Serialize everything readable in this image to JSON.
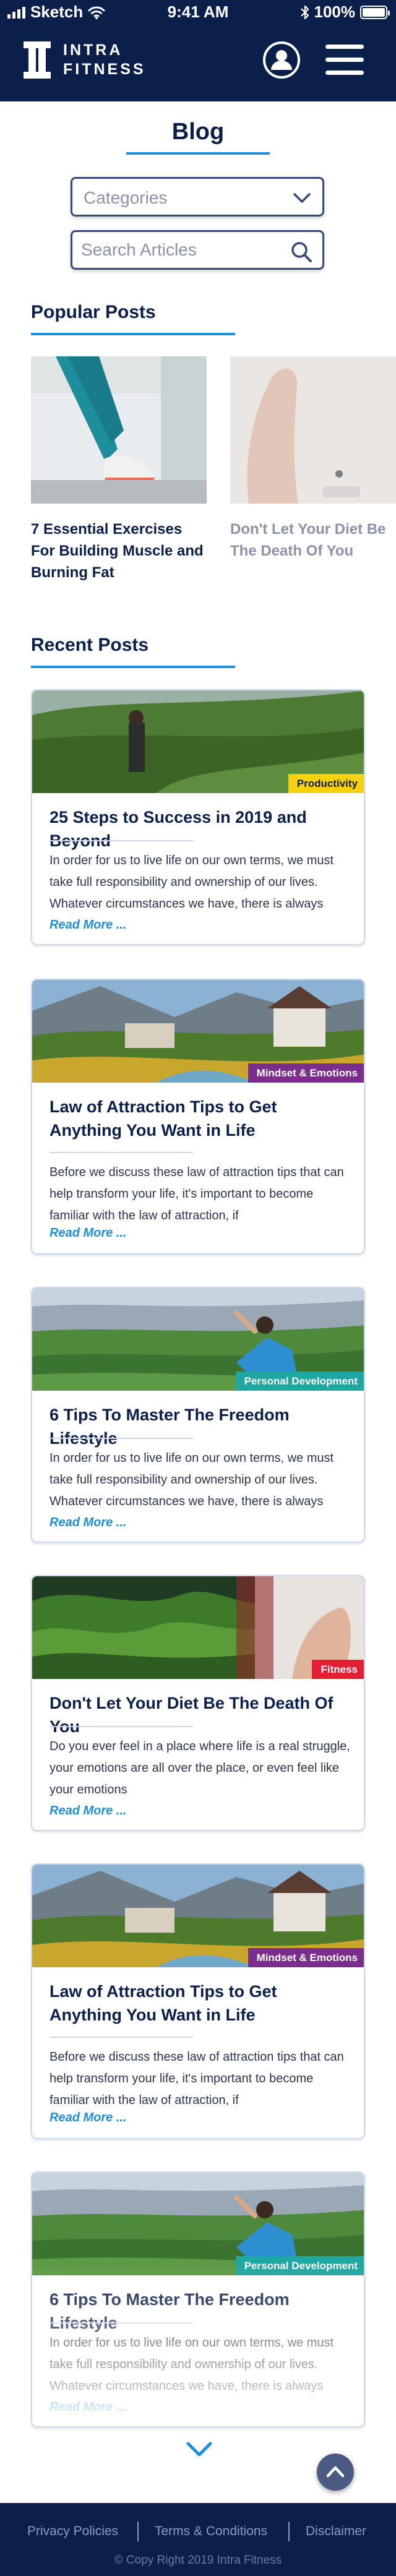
{
  "status_bar": {
    "carrier": "Sketch",
    "time": "9:41 AM",
    "battery": "100%"
  },
  "brand": {
    "line1": "INTRA",
    "line2": "FITNESS"
  },
  "blog_title": "Blog",
  "categories_placeholder": "Categories",
  "search_placeholder": "Search Articles",
  "popular": {
    "heading": "Popular Posts",
    "posts": [
      {
        "title": "7 Essential Exercises For Building Muscle and Burning Fat"
      },
      {
        "title": "Don't Let Your Diet Be The Death Of You"
      }
    ]
  },
  "recent": {
    "heading": "Recent Posts",
    "read_more": "Read More ...",
    "posts": [
      {
        "badge": "Productivity",
        "badge_color": "#f7d10d",
        "title": "25 Steps to Success in 2019 and Beyond",
        "excerpt": "In order for us to live life on our own terms, we must take full responsibility and ownership of our lives. Whatever circumstances we have, there is always"
      },
      {
        "badge": "Mindset & Emotions",
        "badge_color": "#7b2d8e",
        "title": "Law of Attraction Tips to Get Anything You Want in Life",
        "excerpt": "Before we discuss these law of attraction tips that can help transform your life, it's important to become familiar with the law of attraction, if"
      },
      {
        "badge": "Personal Development",
        "badge_color": "#1fa7a3",
        "title": "6 Tips To Master The Freedom Lifestyle",
        "excerpt": "In order for us to live life on our own terms, we must take full responsibility and ownership of our lives. Whatever circumstances we have, there is always"
      },
      {
        "badge": "Fitness",
        "badge_color": "#e41f34",
        "title": "Don't Let Your Diet Be The Death Of You",
        "excerpt": "Do you ever feel in a place where life is a real struggle, your emotions are all over the place, or even feel like your emotions"
      },
      {
        "badge": "Mindset & Emotions",
        "badge_color": "#7b2d8e",
        "title": "Law of Attraction Tips to Get Anything You Want in Life",
        "excerpt": "Before we discuss these law of attraction tips that can help transform your life, it's important to become familiar with the law of attraction, if"
      },
      {
        "badge": "Personal Development",
        "badge_color": "#1fa7a3",
        "title": "6 Tips To Master The Freedom Lifestyle",
        "excerpt": "In order for us to live life on our own terms, we must take full responsibility and ownership of our lives. Whatever circumstances we have, there is always"
      }
    ]
  },
  "footer": {
    "privacy": "Privacy Policies",
    "terms": "Terms & Conditions",
    "disclaimer": "Disclaimer",
    "copyright": "© Copy Right 2019 Intra Fitness"
  },
  "colors": {
    "navy": "#0b1f4b",
    "accent": "#1e8fe0"
  },
  "icons": [
    "cellular-signal-icon",
    "wifi-icon",
    "bluetooth-icon",
    "battery-icon",
    "account-icon",
    "menu-icon",
    "chevron-down-icon",
    "search-icon",
    "scroll-down-icon",
    "scroll-top-icon"
  ]
}
